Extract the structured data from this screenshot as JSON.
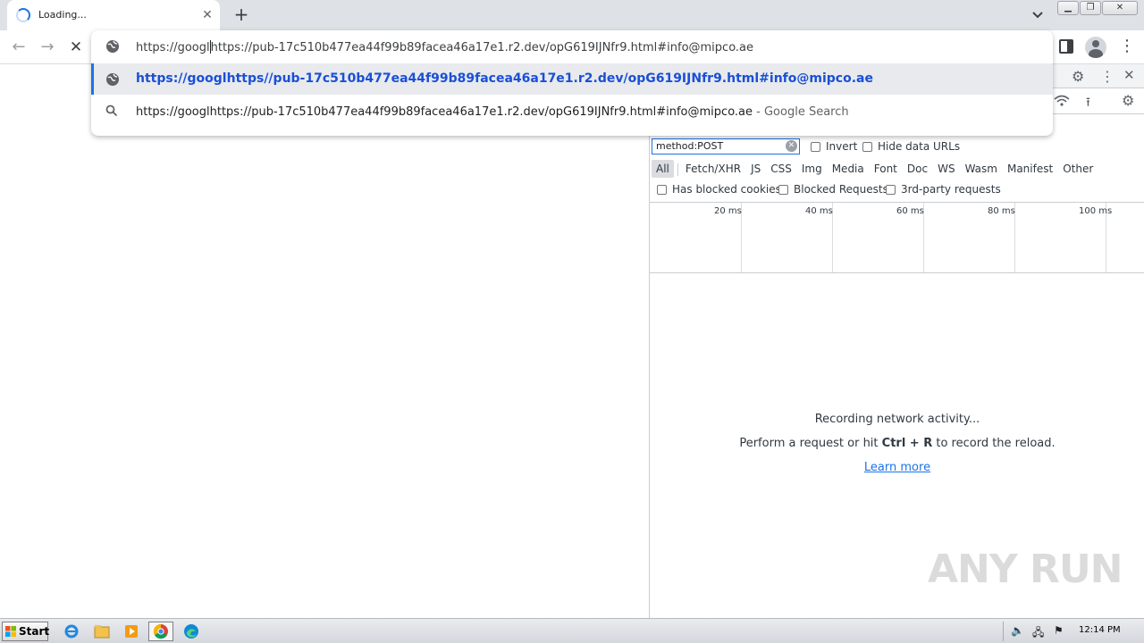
{
  "browser": {
    "tab_title": "Loading...",
    "tab_close_glyph": "✕",
    "new_tab_glyph": "+",
    "nav": {
      "back_glyph": "←",
      "forward_glyph": "→",
      "stop_glyph": "✕"
    }
  },
  "omnibox": {
    "input_before_caret": "https://googl",
    "input_after_caret": "https://pub-17c510b477ea44f99b89facea46a17e1.r2.dev/opG619IJNfr9.html#info@mipco.ae",
    "suggestions": [
      {
        "type": "url",
        "icon": "globe-icon",
        "text": "https://googlhttps//pub-17c510b477ea44f99b89facea46a17e1.r2.dev/opG619IJNfr9.html#info@mipco.ae"
      },
      {
        "type": "search",
        "icon": "search-icon",
        "text": "https://googlhttps://pub-17c510b477ea44f99b89facea46a17e1.r2.dev/opG619IJNfr9.html#info@mipco.ae",
        "suffix": " - Google Search"
      }
    ]
  },
  "devtools": {
    "filter": {
      "value": "method:POST",
      "invert_label": "Invert",
      "hide_data_urls_label": "Hide data URLs"
    },
    "resource_types": [
      "All",
      "Fetch/XHR",
      "JS",
      "CSS",
      "Img",
      "Media",
      "Font",
      "Doc",
      "WS",
      "Wasm",
      "Manifest",
      "Other"
    ],
    "active_type": "All",
    "checkboxes": {
      "blocked_cookies": "Has blocked cookies",
      "blocked_requests": "Blocked Requests",
      "third_party": "3rd-party requests"
    },
    "timeline_ticks": [
      "20 ms",
      "40 ms",
      "60 ms",
      "80 ms",
      "100 ms"
    ],
    "empty_state": {
      "title": "Recording network activity...",
      "hint_prefix": "Perform a request or hit ",
      "hint_keys": "Ctrl + R",
      "hint_suffix": " to record the reload.",
      "link": "Learn more"
    }
  },
  "watermark": "ANY RUN",
  "taskbar": {
    "start_label": "Start",
    "clock": "12:14 PM"
  },
  "colors": {
    "accent": "#1a73e8",
    "tabstrip": "#dee1e6",
    "selected_suggestion": "#e8eaed"
  }
}
